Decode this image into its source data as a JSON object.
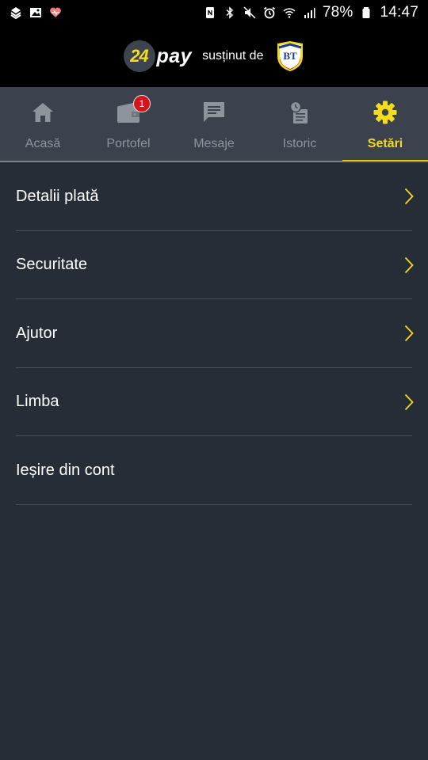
{
  "status_bar": {
    "battery_percent": "78%",
    "time": "14:47",
    "left_icons": [
      "app-notification-icon",
      "gallery-icon",
      "health-icon"
    ],
    "right_icons": [
      "nfc-icon",
      "bluetooth-icon",
      "mute-icon",
      "alarm-icon",
      "wifi-icon",
      "signal-icon",
      "battery-icon"
    ]
  },
  "header": {
    "logo_number": "24",
    "logo_word": "pay",
    "supported_by": "susținut de",
    "partner_logo": "BT"
  },
  "tabs": [
    {
      "label": "Acasă",
      "icon": "home-icon",
      "active": false
    },
    {
      "label": "Portofel",
      "icon": "wallet-icon",
      "active": false,
      "badge": "1"
    },
    {
      "label": "Mesaje",
      "icon": "message-icon",
      "active": false
    },
    {
      "label": "Istoric",
      "icon": "history-icon",
      "active": false
    },
    {
      "label": "Setări",
      "icon": "gear-icon",
      "active": true
    }
  ],
  "menu": [
    {
      "label": "Detalii plată",
      "chevron": true
    },
    {
      "label": "Securitate",
      "chevron": true
    },
    {
      "label": "Ajutor",
      "chevron": true
    },
    {
      "label": "Limba",
      "chevron": true
    },
    {
      "label": "Ieșire din cont",
      "chevron": false
    }
  ],
  "colors": {
    "accent": "#f3dc1e",
    "background": "#262d37",
    "tab_bar": "#3b424e",
    "inactive": "#8e949c",
    "badge": "#d3141c"
  }
}
